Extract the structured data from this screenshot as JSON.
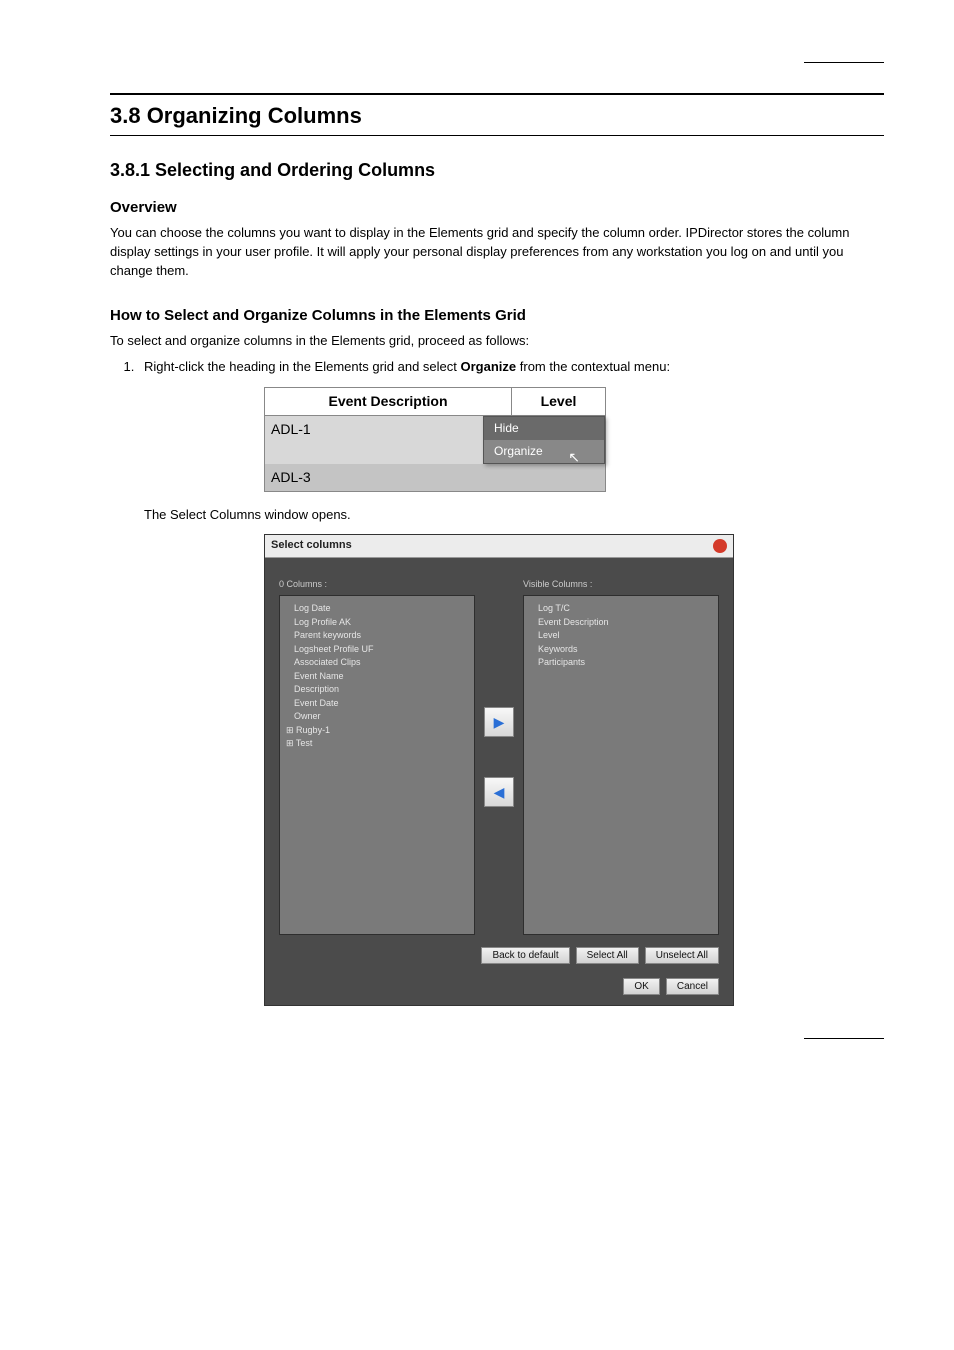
{
  "header_right": "",
  "section_title": "3.8     Organizing Columns",
  "sub1_title": "3.8.1     Selecting and Ordering Columns",
  "overview_label": "Overview",
  "overview_text": "You can choose the columns you want to display in the Elements grid and specify the column order. IPDirector stores the column display settings in your user profile. It will apply your personal display preferences from any workstation you log on and until you change them.",
  "howto_label": "How to Select and Organize Columns in the Elements Grid",
  "intro": "To select and organize columns in the Elements grid, proceed as follows:",
  "step1_pre": "Right-click the heading in the Elements grid and select ",
  "step1_bold": "Organize",
  "step1_post": " from the contextual menu:",
  "step2": "The Select Columns window opens.",
  "fig1": {
    "col1_header": "Event Description",
    "col2_header": "Level",
    "row1": "ADL-1",
    "row2": "ADL-3",
    "menu_hide": "Hide",
    "menu_organize": "Organize"
  },
  "fig2": {
    "title": "Select columns",
    "left_label": "0 Columns :",
    "right_label": "Visible Columns :",
    "left_items": [
      "Log Date",
      "Log Profile AK",
      "Parent keywords",
      "Logsheet Profile UF",
      "Associated Clips",
      "Event Name",
      "Description",
      "Event Date",
      "Owner"
    ],
    "left_roots": [
      "Rugby-1",
      "Test"
    ],
    "right_items": [
      "Log T/C",
      "Event Description",
      "Level",
      "Keywords",
      "Participants"
    ],
    "back_default": "Back to default",
    "select_all": "Select All",
    "unselect_all": "Unselect All",
    "ok": "OK",
    "cancel": "Cancel"
  },
  "footer_right": ""
}
